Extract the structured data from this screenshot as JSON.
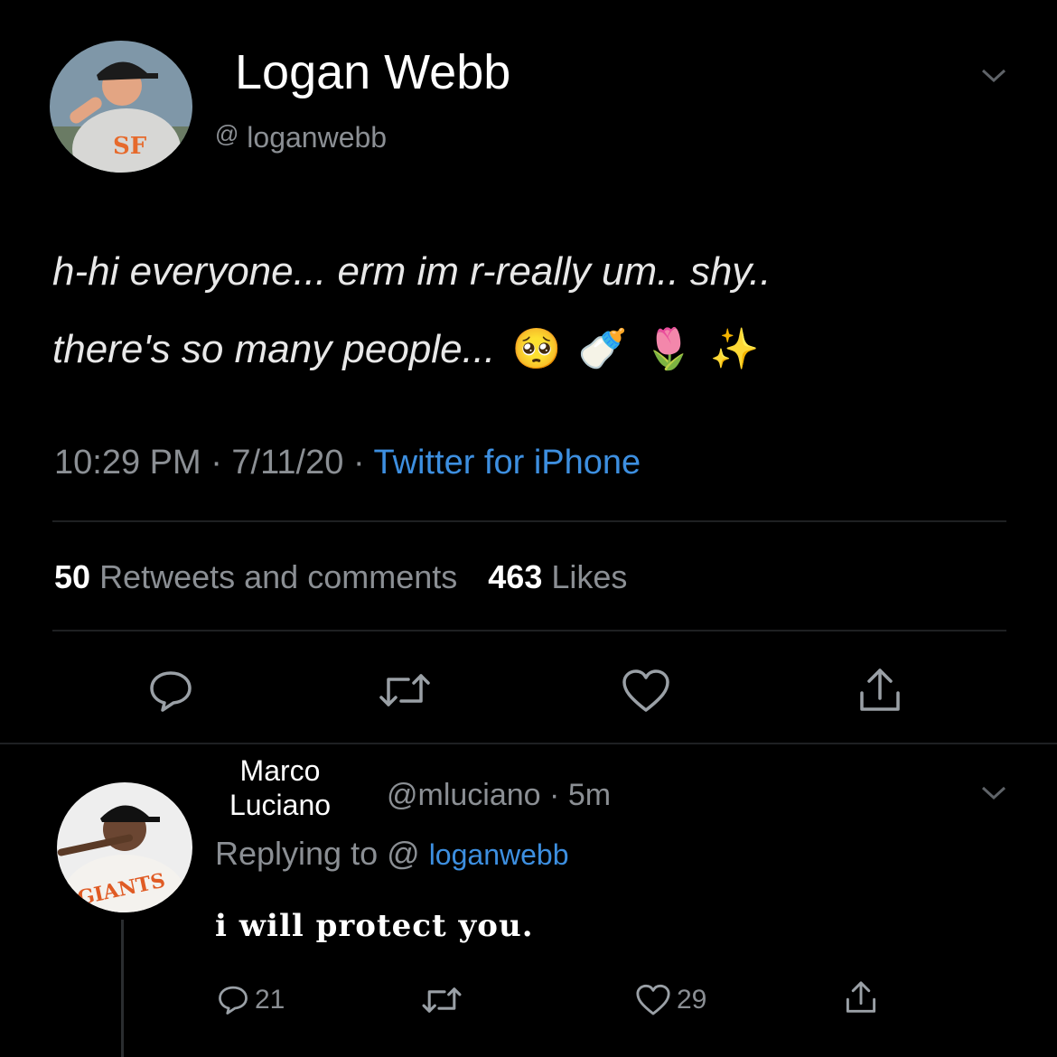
{
  "tweet": {
    "display_name": "Logan Webb",
    "at_symbol": "@",
    "handle": "loganwebb",
    "text_line1": "h-hi everyone... erm im r-really um.. shy..",
    "text_line2": "there's so many people...",
    "emojis": [
      "🥺",
      "🍼",
      "🌷",
      "✨"
    ],
    "timestamp": "10:29 PM · 7/11/20 · ",
    "source": "Twitter for iPhone",
    "retweets_count": "50",
    "retweets_label": "Retweets and comments",
    "likes_count": "463",
    "likes_label": "Likes"
  },
  "reply": {
    "display_name_line1": "Marco",
    "display_name_line2": "Luciano",
    "handle": "@mluciano",
    "time": "· 5m",
    "replying_prefix": "Replying to",
    "replying_at": "@",
    "replying_handle": "loganwebb",
    "text": "i will protect you.",
    "reply_count": "21",
    "like_count": "29",
    "jersey_text": "GIANTS"
  },
  "icons": [
    "chevron-down-icon",
    "reply-icon",
    "retweet-icon",
    "heart-icon",
    "share-icon"
  ],
  "colors": {
    "background": "#000000",
    "link": "#3d8fe0",
    "muted": "#8b8f94"
  }
}
